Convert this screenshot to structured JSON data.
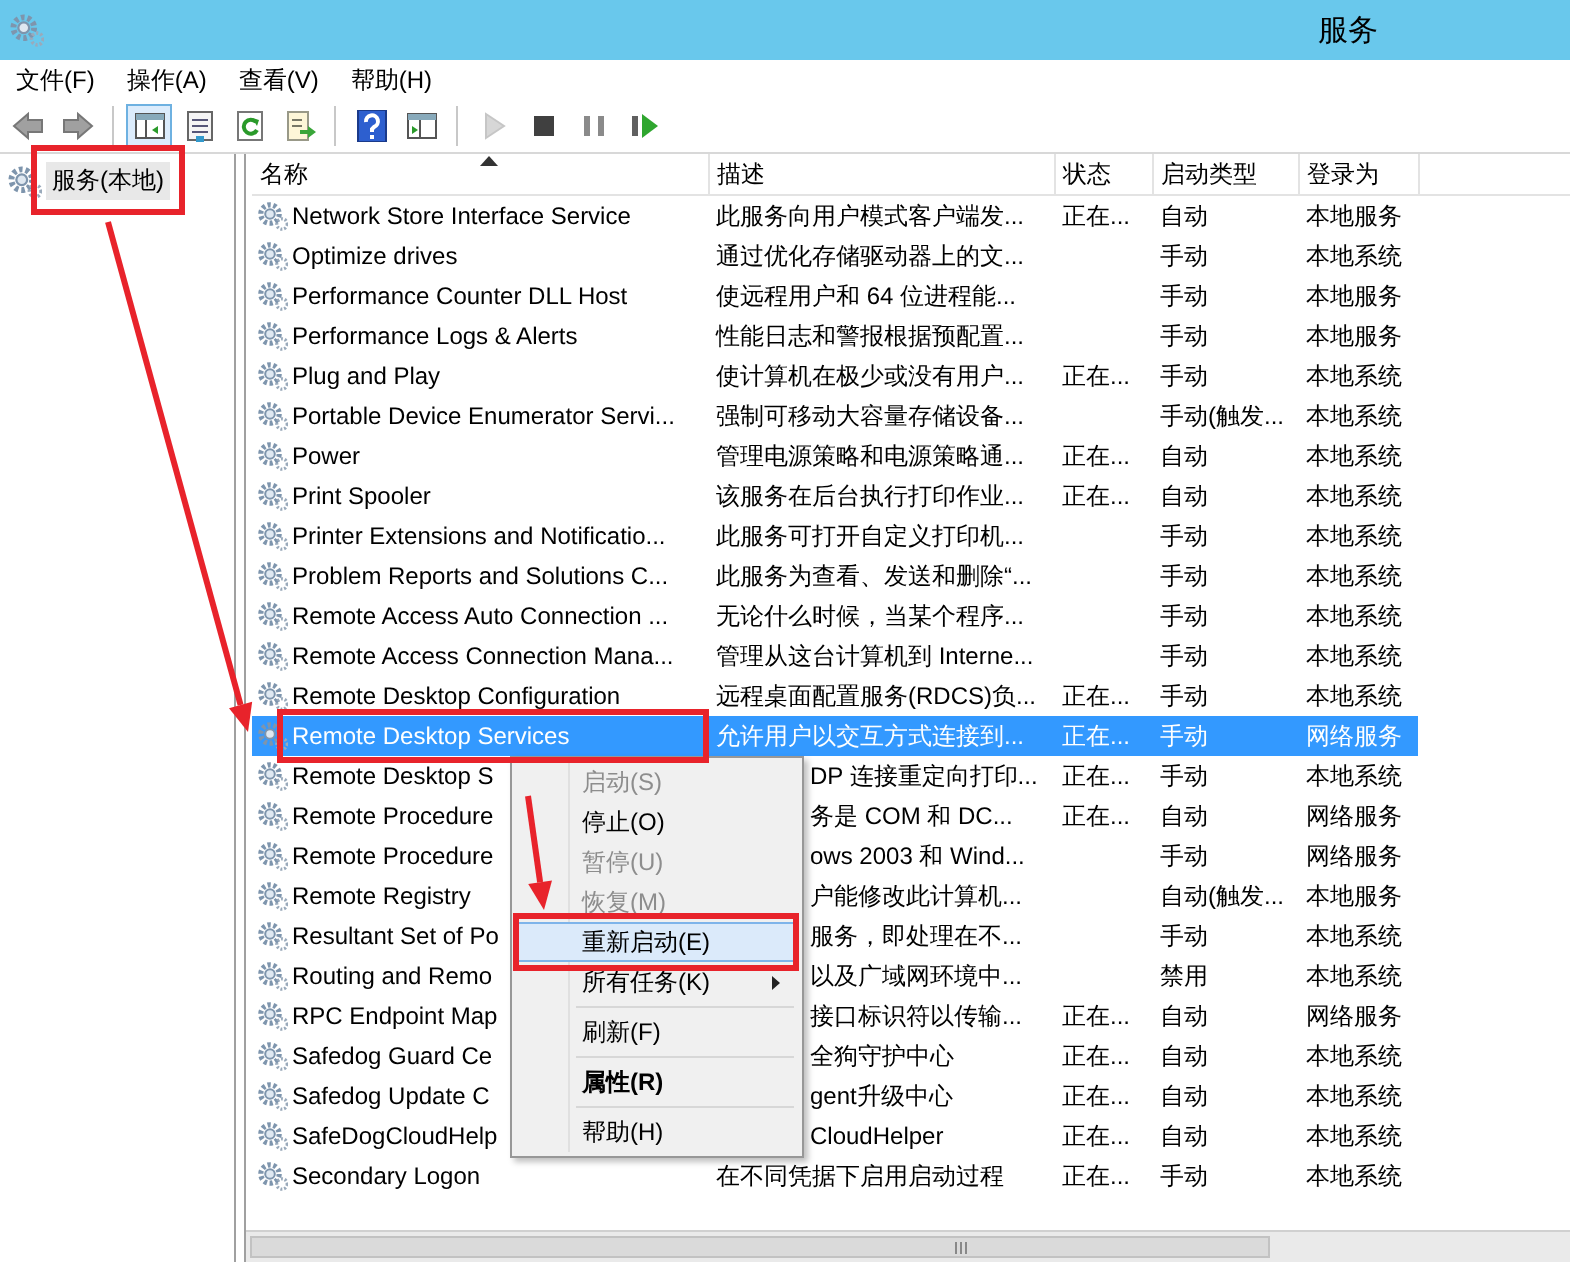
{
  "window": {
    "title": "服务"
  },
  "menu_bar": [
    "文件(F)",
    "操作(A)",
    "查看(V)",
    "帮助(H)"
  ],
  "toolbar": [
    {
      "kind": "back",
      "disabled": false
    },
    {
      "kind": "forward",
      "disabled": false
    },
    {
      "kind": "separator"
    },
    {
      "kind": "tree",
      "pressed": true
    },
    {
      "kind": "properties",
      "pressed": false
    },
    {
      "kind": "refresh",
      "pressed": false
    },
    {
      "kind": "export",
      "pressed": false
    },
    {
      "kind": "separator"
    },
    {
      "kind": "help",
      "pressed": false
    },
    {
      "kind": "view",
      "pressed": false
    },
    {
      "kind": "separator"
    },
    {
      "kind": "start",
      "disabled": true
    },
    {
      "kind": "stop",
      "disabled": false
    },
    {
      "kind": "pause",
      "disabled": false
    },
    {
      "kind": "restart",
      "disabled": false
    }
  ],
  "tree": [
    {
      "label": "服务(本地)",
      "selected": true
    }
  ],
  "table": {
    "columns": [
      {
        "label": "名称",
        "sorted": true
      },
      {
        "label": "描述",
        "sorted": false
      },
      {
        "label": "状态",
        "sorted": false
      },
      {
        "label": "启动类型",
        "sorted": false
      },
      {
        "label": "登录为",
        "sorted": false
      }
    ],
    "rows": [
      {
        "cells": [
          "Network Store Interface Service",
          "此服务向用户模式客户端发...",
          "正在...",
          "自动",
          "本地服务"
        ],
        "selected": false
      },
      {
        "cells": [
          "Optimize drives",
          "通过优化存储驱动器上的文...",
          "",
          "手动",
          "本地系统"
        ],
        "selected": false
      },
      {
        "cells": [
          "Performance Counter DLL Host",
          "使远程用户和 64 位进程能...",
          "",
          "手动",
          "本地服务"
        ],
        "selected": false
      },
      {
        "cells": [
          "Performance Logs & Alerts",
          "性能日志和警报根据预配置...",
          "",
          "手动",
          "本地服务"
        ],
        "selected": false
      },
      {
        "cells": [
          "Plug and Play",
          "使计算机在极少或没有用户...",
          "正在...",
          "手动",
          "本地系统"
        ],
        "selected": false
      },
      {
        "cells": [
          "Portable Device Enumerator Servi...",
          "强制可移动大容量存储设备...",
          "",
          "手动(触发...",
          "本地系统"
        ],
        "selected": false
      },
      {
        "cells": [
          "Power",
          "管理电源策略和电源策略通...",
          "正在...",
          "自动",
          "本地系统"
        ],
        "selected": false
      },
      {
        "cells": [
          "Print Spooler",
          "该服务在后台执行打印作业...",
          "正在...",
          "自动",
          "本地系统"
        ],
        "selected": false
      },
      {
        "cells": [
          "Printer Extensions and Notificatio...",
          "此服务可打开自定义打印机...",
          "",
          "手动",
          "本地系统"
        ],
        "selected": false
      },
      {
        "cells": [
          "Problem Reports and Solutions C...",
          "此服务为查看、发送和删除“...",
          "",
          "手动",
          "本地系统"
        ],
        "selected": false
      },
      {
        "cells": [
          "Remote Access Auto Connection ...",
          "无论什么时候，当某个程序...",
          "",
          "手动",
          "本地系统"
        ],
        "selected": false
      },
      {
        "cells": [
          "Remote Access Connection Mana...",
          "管理从这台计算机到 Interne...",
          "",
          "手动",
          "本地系统"
        ],
        "selected": false
      },
      {
        "cells": [
          "Remote Desktop Configuration",
          "远程桌面配置服务(RDCS)负...",
          "正在...",
          "手动",
          "本地系统"
        ],
        "selected": false
      },
      {
        "cells": [
          "Remote Desktop Services",
          "允许用户以交互方式连接到...",
          "正在...",
          "手动",
          "网络服务"
        ],
        "selected": true
      },
      {
        "cells": [
          "Remote Desktop S",
          "DP 连接重定向打印...",
          "正在...",
          "手动",
          "本地系统"
        ],
        "selected": false
      },
      {
        "cells": [
          "Remote Procedure",
          "务是 COM 和 DC...",
          "正在...",
          "自动",
          "网络服务"
        ],
        "selected": false
      },
      {
        "cells": [
          "Remote Procedure",
          "ows 2003 和 Wind...",
          "",
          "手动",
          "网络服务"
        ],
        "selected": false
      },
      {
        "cells": [
          "Remote Registry",
          "户能修改此计算机...",
          "",
          "自动(触发...",
          "本地服务"
        ],
        "selected": false
      },
      {
        "cells": [
          "Resultant Set of Po",
          "服务，即处理在不...",
          "",
          "手动",
          "本地系统"
        ],
        "selected": false
      },
      {
        "cells": [
          "Routing and Remo",
          "以及广域网环境中...",
          "",
          "禁用",
          "本地系统"
        ],
        "selected": false
      },
      {
        "cells": [
          "RPC Endpoint Map",
          "接口标识符以传输...",
          "正在...",
          "自动",
          "网络服务"
        ],
        "selected": false
      },
      {
        "cells": [
          "Safedog Guard Ce",
          "全狗守护中心",
          "正在...",
          "自动",
          "本地系统"
        ],
        "selected": false
      },
      {
        "cells": [
          "Safedog Update C",
          "gent升级中心",
          "正在...",
          "自动",
          "本地系统"
        ],
        "selected": false
      },
      {
        "cells": [
          "SafeDogCloudHelp",
          "CloudHelper",
          "正在...",
          "自动",
          "本地系统"
        ],
        "selected": false
      },
      {
        "cells": [
          "Secondary Logon",
          "在不同凭据下启用启动过程",
          "正在...",
          "手动",
          "本地系统"
        ],
        "selected": false
      }
    ]
  },
  "context_menu": {
    "items": [
      {
        "kind": "item",
        "label": "启动(S)",
        "disabled": true,
        "selected": false,
        "default": false
      },
      {
        "kind": "item",
        "label": "停止(O)",
        "disabled": false,
        "selected": false,
        "default": false
      },
      {
        "kind": "item",
        "label": "暂停(U)",
        "disabled": true,
        "selected": false,
        "default": false
      },
      {
        "kind": "item",
        "label": "恢复(M)",
        "disabled": true,
        "selected": false,
        "default": false
      },
      {
        "kind": "item",
        "label": "重新启动(E)",
        "disabled": false,
        "selected": true,
        "default": false
      },
      {
        "kind": "submenu",
        "label": "所有任务(K)",
        "disabled": false,
        "selected": false,
        "default": false
      },
      {
        "kind": "separator"
      },
      {
        "kind": "item",
        "label": "刷新(F)",
        "disabled": false,
        "selected": false,
        "default": false
      },
      {
        "kind": "separator"
      },
      {
        "kind": "item",
        "label": "属性(R)",
        "disabled": false,
        "selected": false,
        "default": true
      },
      {
        "kind": "separator"
      },
      {
        "kind": "item",
        "label": "帮助(H)",
        "disabled": false,
        "selected": false,
        "default": false
      }
    ]
  }
}
